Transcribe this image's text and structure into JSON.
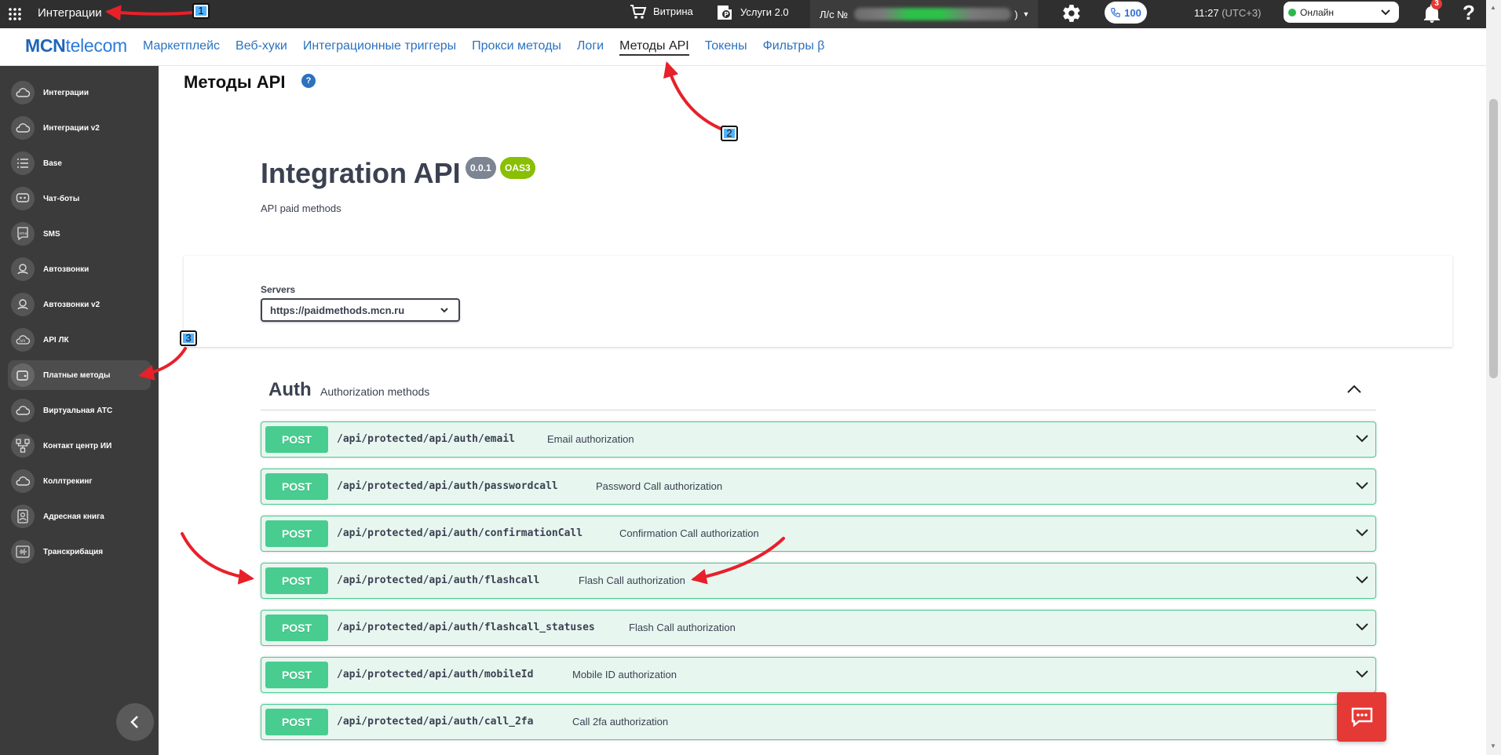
{
  "topbar": {
    "app_title": "Интеграции",
    "showcase": "Витрина",
    "services": "Услуги 2.0",
    "account_prefix": "Л/с №",
    "account_suffix": ")",
    "calls_count": "100",
    "time": "11:27",
    "timezone": "(UTC+3)",
    "status": "Онлайн",
    "status_color": "#2db84d",
    "notifications": "3",
    "help": "?"
  },
  "nav": {
    "logo_bold": "MCN",
    "logo_rest": "telecom",
    "links": [
      "Маркетплейс",
      "Веб-хуки",
      "Интеграционные триггеры",
      "Прокси методы",
      "Логи",
      "Методы API",
      "Токены",
      "Фильтры β"
    ],
    "active_link": "Методы API"
  },
  "sidebar": {
    "items": [
      {
        "label": "Интеграции",
        "icon": "cloud-settings-icon"
      },
      {
        "label": "Интеграции v2",
        "icon": "cloud-settings-icon"
      },
      {
        "label": "Base",
        "icon": "list-icon"
      },
      {
        "label": "Чат-боты",
        "icon": "chat-bot-icon"
      },
      {
        "label": "SMS",
        "icon": "sms-icon"
      },
      {
        "label": "Автозвонки",
        "icon": "auto-call-icon"
      },
      {
        "label": "Автозвонки v2",
        "icon": "auto-call-icon"
      },
      {
        "label": "API ЛК",
        "icon": "api-cloud-icon"
      },
      {
        "label": "Платные методы",
        "icon": "wallet-icon"
      },
      {
        "label": "Виртуальная АТС",
        "icon": "cloud-phone-icon"
      },
      {
        "label": "Контакт центр ИИ",
        "icon": "network-icon"
      },
      {
        "label": "Коллтрекинг",
        "icon": "tracking-icon"
      },
      {
        "label": "Адресная книга",
        "icon": "contact-book-icon"
      },
      {
        "label": "Транскрибация",
        "icon": "waveform-icon"
      }
    ],
    "active_index": 8
  },
  "main": {
    "page_title": "Методы API",
    "page_help": "?",
    "api_title": "Integration API",
    "version": "0.0.1",
    "oas": "OAS3",
    "description": "API paid methods",
    "servers_label": "Servers",
    "server_selected": "https://paidmethods.mcn.ru",
    "section": {
      "name": "Auth",
      "description": "Authorization methods"
    },
    "operations": [
      {
        "method": "POST",
        "path": "/api/protected/api/auth/email",
        "summary": "Email authorization"
      },
      {
        "method": "POST",
        "path": "/api/protected/api/auth/passwordcall",
        "summary": "Password Call authorization"
      },
      {
        "method": "POST",
        "path": "/api/protected/api/auth/confirmationCall",
        "summary": "Confirmation Call authorization"
      },
      {
        "method": "POST",
        "path": "/api/protected/api/auth/flashcall",
        "summary": "Flash Call authorization"
      },
      {
        "method": "POST",
        "path": "/api/protected/api/auth/flashcall_statuses",
        "summary": "Flash Call authorization"
      },
      {
        "method": "POST",
        "path": "/api/protected/api/auth/mobileId",
        "summary": "Mobile ID authorization"
      },
      {
        "method": "POST",
        "path": "/api/protected/api/auth/call_2fa",
        "summary": "Call 2fa authorization"
      }
    ]
  },
  "annotations": {
    "step1": "1",
    "step2": "2",
    "step3": "3"
  },
  "colors": {
    "post": "#49cc90",
    "post_bg": "#e8f6f0",
    "accent": "#2b72c0",
    "sidebar": "#3b3b3b",
    "topbar": "#2f2f2f",
    "annotation_arrow": "#e8202a"
  }
}
